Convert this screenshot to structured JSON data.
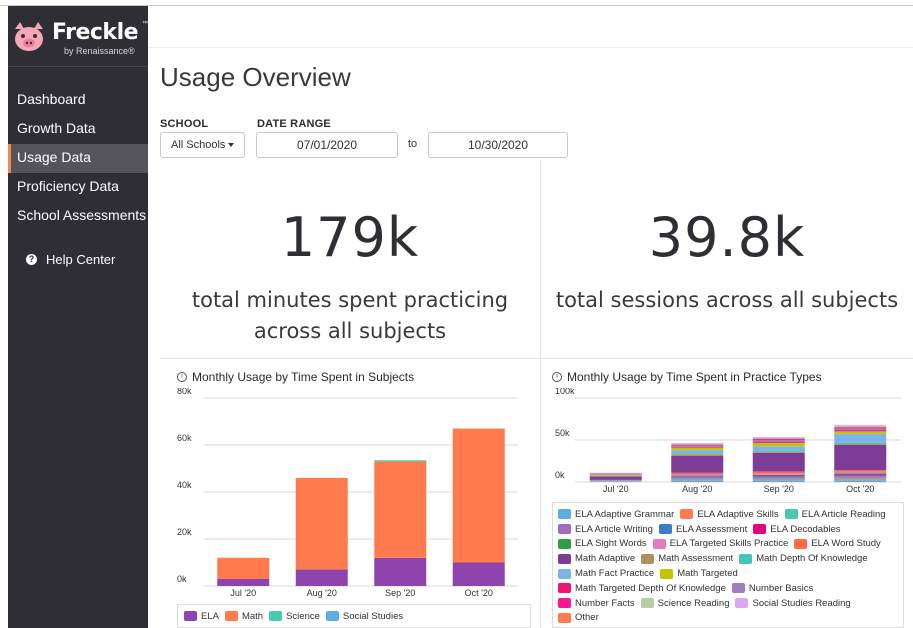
{
  "app": {
    "logo_name": "Freckle",
    "logo_tm": "™",
    "logo_sub": "by Renaissance®"
  },
  "sidebar": {
    "items": [
      {
        "label": "Dashboard",
        "active": false
      },
      {
        "label": "Growth Data",
        "active": false
      },
      {
        "label": "Usage Data",
        "active": true
      },
      {
        "label": "Proficiency Data",
        "active": false
      },
      {
        "label": "School Assessments",
        "active": false
      }
    ],
    "help_label": "Help Center",
    "help_icon": "question-circle-icon"
  },
  "main": {
    "title": "Usage Overview",
    "filters": {
      "school_label": "SCHOOL",
      "school_value": "All Schools",
      "date_label": "DATE RANGE",
      "date_from": "07/01/2020",
      "to_label": "to",
      "date_to": "10/30/2020"
    },
    "stats": [
      {
        "value": "179k",
        "line1": "total minutes spent practicing",
        "line2": "across all subjects"
      },
      {
        "value": "39.8k",
        "line1": "total sessions across all subjects",
        "line2": ""
      }
    ]
  },
  "colors": {
    "ELA": "#8e44ad",
    "Math": "#ff7a4d",
    "Science": "#48c9b0",
    "Social Studies": "#5dade2",
    "accent": "#f28a4b",
    "sidebar_bg": "#2f2e35"
  },
  "chart_data": [
    {
      "type": "bar",
      "stacked": true,
      "title": "Monthly Usage by Time Spent in Subjects",
      "info_icon": "ⓘ",
      "categories": [
        "Jul '20",
        "Aug '20",
        "Sep '20",
        "Oct '20"
      ],
      "ylim": [
        0,
        80000
      ],
      "ytick_labels": [
        "0k",
        "20k",
        "40k",
        "60k",
        "80k"
      ],
      "ytick_values": [
        0,
        20000,
        40000,
        60000,
        80000
      ],
      "grid": true,
      "series": [
        {
          "name": "ELA",
          "color": "#8e44ad",
          "values": [
            3000,
            7000,
            12000,
            10000
          ]
        },
        {
          "name": "Math",
          "color": "#ff7a4d",
          "values": [
            9000,
            39000,
            41000,
            57000
          ]
        },
        {
          "name": "Science",
          "color": "#48c9b0",
          "values": [
            0,
            0,
            500,
            0
          ]
        },
        {
          "name": "Social Studies",
          "color": "#5dade2",
          "values": [
            0,
            0,
            0,
            0
          ]
        }
      ]
    },
    {
      "type": "bar",
      "stacked": true,
      "title": "Monthly Usage by Time Spent in Practice Types",
      "info_icon": "ⓘ",
      "categories": [
        "Jul '20",
        "Aug '20",
        "Sep '20",
        "Oct '20"
      ],
      "ylim": [
        0,
        100000
      ],
      "ytick_labels": [
        "0k",
        "50k",
        "100k"
      ],
      "ytick_values": [
        0,
        50000,
        100000
      ],
      "grid": true,
      "series": [
        {
          "name": "ELA Adaptive Grammar",
          "color": "#5dade2",
          "values": [
            500,
            2000,
            2000,
            2000
          ]
        },
        {
          "name": "ELA Adaptive Skills",
          "color": "#ff7a4d",
          "values": [
            300,
            1000,
            1000,
            1500
          ]
        },
        {
          "name": "ELA Article Reading",
          "color": "#48c9b0",
          "values": [
            300,
            1000,
            1000,
            1500
          ]
        },
        {
          "name": "ELA Article Writing",
          "color": "#a569bd",
          "values": [
            300,
            1500,
            1500,
            2000
          ]
        },
        {
          "name": "ELA Assessment",
          "color": "#3d7cc9",
          "values": [
            500,
            1500,
            1500,
            1500
          ]
        },
        {
          "name": "ELA Decodables",
          "color": "#e6007e",
          "values": [
            0,
            500,
            800,
            1000
          ]
        },
        {
          "name": "ELA Sight Words",
          "color": "#2ea043",
          "values": [
            0,
            500,
            800,
            800
          ]
        },
        {
          "name": "ELA Targeted Skills Practice",
          "color": "#e879b9",
          "values": [
            300,
            1500,
            2000,
            2000
          ]
        },
        {
          "name": "ELA Word Study",
          "color": "#ff6a3d",
          "values": [
            300,
            1500,
            2000,
            2000
          ]
        },
        {
          "name": "Math Adaptive",
          "color": "#7d3c98",
          "values": [
            4000,
            20000,
            22000,
            30000
          ]
        },
        {
          "name": "Math Assessment",
          "color": "#b08f5e",
          "values": [
            500,
            2000,
            1500,
            1000
          ]
        },
        {
          "name": "Math Depth Of Knowledge",
          "color": "#45c4b8",
          "values": [
            200,
            1000,
            1500,
            2000
          ]
        },
        {
          "name": "Math Fact Practice",
          "color": "#7fb3e6",
          "values": [
            1000,
            4000,
            5000,
            10000
          ]
        },
        {
          "name": "Math Targeted",
          "color": "#c4c400",
          "values": [
            1000,
            3000,
            4000,
            3000
          ]
        },
        {
          "name": "Math Targeted Depth Of Knowledge",
          "color": "#f0147a",
          "values": [
            500,
            1000,
            1500,
            1500
          ]
        },
        {
          "name": "Number Basics",
          "color": "#9b7fc4",
          "values": [
            500,
            1500,
            2000,
            2000
          ]
        },
        {
          "name": "Number Facts",
          "color": "#ff1493",
          "values": [
            300,
            1000,
            1500,
            1500
          ]
        },
        {
          "name": "Science Reading",
          "color": "#b5cfa1",
          "values": [
            300,
            1000,
            1000,
            1500
          ]
        },
        {
          "name": "Social Studies Reading",
          "color": "#d9a8f0",
          "values": [
            200,
            1000,
            1000,
            1200
          ]
        },
        {
          "name": "Other",
          "color": "#ff7a4d",
          "values": [
            0,
            0,
            0,
            0
          ]
        }
      ]
    }
  ]
}
